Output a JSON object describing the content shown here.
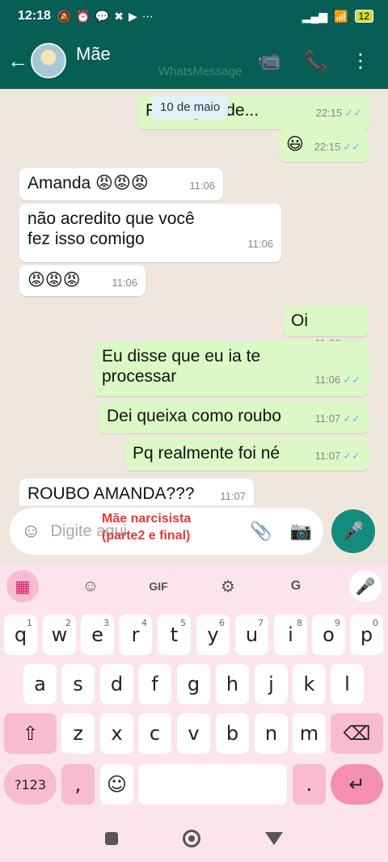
{
  "status_bar": {
    "time": "12:18",
    "icons": [
      "🔕",
      "⏰",
      "💬",
      "✖",
      "▶",
      "⋯"
    ],
    "signal": "▂▄▆",
    "wifi": "📶",
    "battery": "12"
  },
  "header": {
    "back_icon": "←",
    "contact_name": "Mãe",
    "video_icon": "📹",
    "call_icon": "📞",
    "menu_icon": "⋮",
    "watermark": "WhatsMessage"
  },
  "chat": {
    "date_chip": "10 de maio",
    "messages": [
      {
        "dir": "out",
        "text": "Fica aguarde...",
        "time": "22:15",
        "ticks": "✓✓"
      },
      {
        "dir": "out",
        "text": "😃",
        "time": "22:15",
        "ticks": "✓✓"
      },
      {
        "dir": "in",
        "text": "Amanda 😡😡😡",
        "time": "11:06"
      },
      {
        "dir": "in",
        "text": "não acredito que você fez isso comigo",
        "time": "11:06"
      },
      {
        "dir": "in",
        "text": "😡😡😡",
        "time": "11:06"
      },
      {
        "dir": "out",
        "text": "Oi",
        "time": "11:06",
        "ticks": "✓✓"
      },
      {
        "dir": "out",
        "text": "Eu disse que eu ia te processar",
        "time": "11:06",
        "ticks": "✓✓"
      },
      {
        "dir": "out",
        "text": "Dei queixa como roubo",
        "time": "11:07",
        "ticks": "✓✓"
      },
      {
        "dir": "out",
        "text": "Pq realmente foi né",
        "time": "11:07",
        "ticks": "✓✓"
      },
      {
        "dir": "in",
        "text": "ROUBO AMANDA???",
        "time": "11:07"
      }
    ]
  },
  "input": {
    "placeholder": "Digite aqui",
    "emoji_icon": "☺",
    "attach_icon": "📎",
    "camera_icon": "📷",
    "mic_icon": "🎤",
    "caption": [
      "Mãe narcisista",
      "(parte2 e final)"
    ]
  },
  "keyboard": {
    "toolbar": {
      "grid": "▦",
      "sticker": "☺",
      "gif": "GIF",
      "settings": "⚙",
      "translate": "G",
      "mic": "🎤"
    },
    "row1": [
      {
        "k": "q",
        "n": "1"
      },
      {
        "k": "w",
        "n": "2"
      },
      {
        "k": "e",
        "n": "3"
      },
      {
        "k": "r",
        "n": "4"
      },
      {
        "k": "t",
        "n": "5"
      },
      {
        "k": "y",
        "n": "6"
      },
      {
        "k": "u",
        "n": "7"
      },
      {
        "k": "i",
        "n": "8"
      },
      {
        "k": "o",
        "n": "9"
      },
      {
        "k": "p",
        "n": "0"
      }
    ],
    "row2": [
      "a",
      "s",
      "d",
      "f",
      "g",
      "h",
      "j",
      "k",
      "l"
    ],
    "row3": [
      "z",
      "x",
      "c",
      "v",
      "b",
      "n",
      "m"
    ],
    "shift": "⇧",
    "backspace": "⌫",
    "numbers": "?123",
    "comma": ",",
    "emoji": "☺",
    "period": ".",
    "enter": "↵"
  }
}
